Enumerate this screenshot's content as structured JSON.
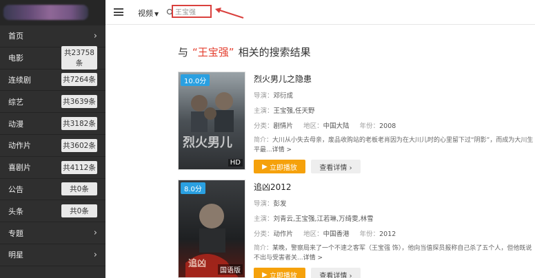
{
  "sidebar": {
    "items": [
      {
        "label": "首页",
        "badge": null,
        "chevron": true
      },
      {
        "label": "电影",
        "badge": "共23758条",
        "chevron": false
      },
      {
        "label": "连续剧",
        "badge": "共7264条",
        "chevron": false
      },
      {
        "label": "综艺",
        "badge": "共3639条",
        "chevron": false
      },
      {
        "label": "动漫",
        "badge": "共3182条",
        "chevron": false
      },
      {
        "label": "动作片",
        "badge": "共3602条",
        "chevron": false
      },
      {
        "label": "喜剧片",
        "badge": "共4112条",
        "chevron": false
      },
      {
        "label": "公告",
        "badge": "共0条",
        "chevron": false
      },
      {
        "label": "头条",
        "badge": "共0条",
        "chevron": false
      },
      {
        "label": "专题",
        "badge": null,
        "chevron": true
      },
      {
        "label": "明星",
        "badge": null,
        "chevron": true
      }
    ]
  },
  "topbar": {
    "channel_label": "视频",
    "search_value": "王宝强"
  },
  "heading": {
    "prefix": "与",
    "keyword": "“王宝强”",
    "suffix": "相关的搜索结果"
  },
  "results": [
    {
      "rating": "10.0分",
      "tag": "HD",
      "title": "烈火男儿之隐患",
      "director_label": "导演：",
      "director": "邓衍成",
      "cast_label": "主演：",
      "cast": "王宝强,任天野",
      "type_label": "分类：",
      "type": "剧情片",
      "region_label": "地区：",
      "region": "中国大陆",
      "year_label": "年份：",
      "year": "2008",
      "desc_label": "简介：",
      "desc": "大川从小失去母亲，废品收购站的老板老肖因为在大川儿时的心里留下过“阴影”，而成为大川生平最...",
      "more": "详情 >",
      "play_label": "立即播放",
      "detail_label": "查看详情 ›"
    },
    {
      "rating": "8.0分",
      "tag": "国语版",
      "title": "追凶2012",
      "director_label": "导演：",
      "director": "彭发",
      "cast_label": "主演：",
      "cast": "刘青云,王宝强,江若琳,万绮雯,林雪",
      "type_label": "分类：",
      "type": "动作片",
      "region_label": "地区：",
      "region": "中国香港",
      "year_label": "年份：",
      "year": "2012",
      "desc_label": "简介：",
      "desc": "某晚，警察局来了一个不速之客军（王宝强 饰），他向当值探员报称自己杀了五个人，但他既说不出与受害者关...",
      "more": "详情 >",
      "play_label": "立即播放",
      "detail_label": "查看详情 ›"
    }
  ]
}
